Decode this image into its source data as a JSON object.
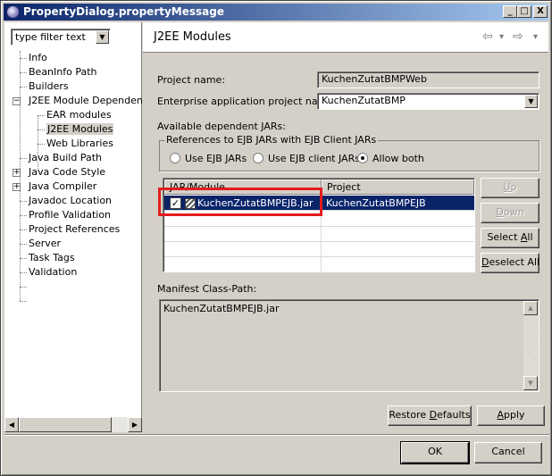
{
  "window": {
    "title": "PropertyDialog.propertyMessage",
    "controls": {
      "minimize": "_",
      "maximize": "□",
      "close": "X"
    }
  },
  "sidebar": {
    "filter_value": "type filter text",
    "items": [
      {
        "label": "Info"
      },
      {
        "label": "BeanInfo Path"
      },
      {
        "label": "Builders"
      },
      {
        "label": "J2EE Module Dependencies"
      },
      {
        "label": "EAR modules"
      },
      {
        "label": "J2EE Modules"
      },
      {
        "label": "Web Libraries"
      },
      {
        "label": "Java Build Path"
      },
      {
        "label": "Java Code Style"
      },
      {
        "label": "Java Compiler"
      },
      {
        "label": "Javadoc Location"
      },
      {
        "label": "Profile Validation"
      },
      {
        "label": "Project References"
      },
      {
        "label": "Server"
      },
      {
        "label": "Task Tags"
      },
      {
        "label": "Validation"
      }
    ],
    "expander_minus": "−",
    "expander_plus": "+"
  },
  "page": {
    "title": "J2EE Modules",
    "nav_back": "⇦",
    "nav_forward": "⇨",
    "nav_menu": "▾",
    "project_name_label": "Project name:",
    "project_name_value": "KuchenZutatBMPWeb",
    "ear_label": "Enterprise application project name:",
    "ear_value": "KuchenZutatBMP",
    "available_label": "Available dependent JARs:",
    "group_title": "References to EJB JARs with EJB Client JARs",
    "radios": [
      {
        "label": "Use EJB JARs",
        "selected": false
      },
      {
        "label": "Use EJB client JARs",
        "selected": false
      },
      {
        "label": "Allow both",
        "selected": true
      }
    ],
    "table": {
      "headers": [
        "JAR/Module",
        "Project"
      ],
      "rows": [
        {
          "jar": "KuchenZutatBMPEJB.jar",
          "project": "KuchenZutatBMPEJB",
          "checked": true,
          "check_mark": "✓"
        }
      ]
    },
    "buttons": {
      "up": {
        "pre": "",
        "mnemonic": "U",
        "post": "p"
      },
      "down": {
        "pre": "",
        "mnemonic": "D",
        "post": "own"
      },
      "select_all": {
        "pre": "Select ",
        "mnemonic": "A",
        "post": "ll"
      },
      "deselect_all": {
        "pre": "",
        "mnemonic": "D",
        "post": "eselect All"
      }
    },
    "manifest_label": "Manifest Class-Path:",
    "manifest_value": "KuchenZutatBMPEJB.jar",
    "restore_defaults": {
      "pre": "Restore ",
      "mnemonic": "D",
      "post": "efaults"
    },
    "apply": {
      "pre": "",
      "mnemonic": "A",
      "post": "pply"
    }
  },
  "footer": {
    "ok_label": "OK",
    "cancel_label": "Cancel"
  },
  "colors": {
    "highlight_box": "#e31c1c",
    "selection": "#0a246a",
    "titlebar": "#0a246a"
  }
}
